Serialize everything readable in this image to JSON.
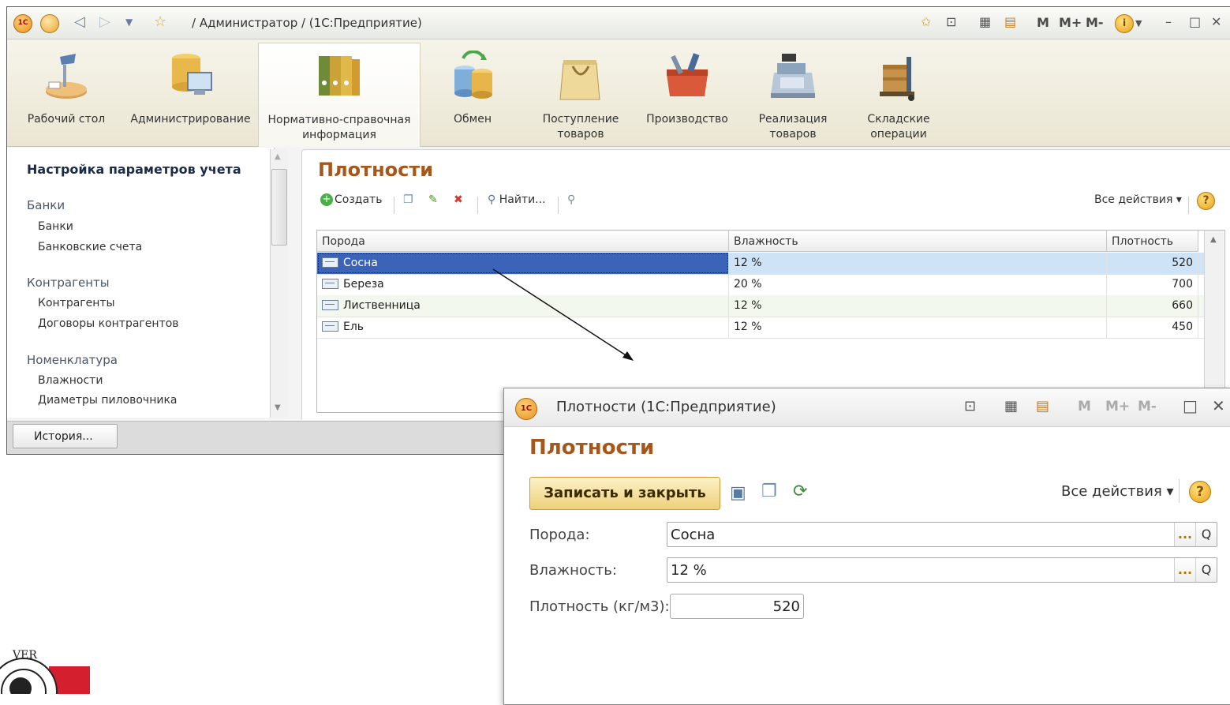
{
  "main_window": {
    "title": "/ Администратор / (1С:Предприятие)",
    "toolbar_right": {
      "m": "M",
      "m_plus": "M+",
      "m_minus": "M-"
    },
    "sections": [
      {
        "label": "Рабочий стол",
        "icon": "desk-lamp-icon"
      },
      {
        "label": "Администрирование",
        "icon": "database-computer-icon"
      },
      {
        "label": "Нормативно-справочная информация",
        "icon": "binders-icon"
      },
      {
        "label": "Обмен",
        "icon": "exchange-icon"
      },
      {
        "label": "Поступление товаров",
        "icon": "shopping-bag-icon"
      },
      {
        "label": "Производство",
        "icon": "toolbox-icon"
      },
      {
        "label": "Реализация товаров",
        "icon": "cash-register-icon"
      },
      {
        "label": "Складские операции",
        "icon": "pallet-truck-icon"
      }
    ],
    "active_section": "Нормативно-справочная информация",
    "left_nav": {
      "header": "Настройка параметров учета",
      "groups": [
        {
          "title": "Банки",
          "items": [
            "Банки",
            "Банковские счета"
          ]
        },
        {
          "title": "Контрагенты",
          "items": [
            "Контрагенты",
            "Договоры контрагентов"
          ]
        },
        {
          "title": "Номенклатура",
          "items": [
            "Влажности",
            "Диаметры пиловочника"
          ]
        }
      ]
    },
    "list": {
      "title": "Плотности",
      "toolbar": {
        "create": "Создать",
        "find": "Найти...",
        "all_actions": "Все действия ▾",
        "help": "?"
      },
      "columns": [
        "Порода",
        "Влажность",
        "Плотность"
      ],
      "rows": [
        {
          "species": "Сосна",
          "humidity": "12 %",
          "density": "520",
          "selected": true
        },
        {
          "species": "Береза",
          "humidity": "20 %",
          "density": "700"
        },
        {
          "species": "Лиственница",
          "humidity": "12 %",
          "density": "660"
        },
        {
          "species": "Ель",
          "humidity": "12 %",
          "density": "450"
        }
      ]
    },
    "history_button": "История..."
  },
  "dialog": {
    "title": "Плотности  (1С:Предприятие)",
    "form_title": "Плотности",
    "save_close": "Записать и закрыть",
    "all_actions": "Все действия ▾",
    "help": "?",
    "toolbar_right": {
      "m": "M",
      "m_plus": "M+",
      "m_minus": "M-"
    },
    "fields": {
      "species_label": "Порода:",
      "species_value": "Сосна",
      "humidity_label": "Влажность:",
      "humidity_value": "12 %",
      "density_label": "Плотность (кг/м3):",
      "density_value": "520"
    },
    "select_button": "...",
    "open_button": "Q"
  },
  "logo_text": "VER",
  "colors": {
    "accent_title": "#a8571a",
    "selection": "#3b63b8",
    "logo_red": "#d31f2e"
  }
}
